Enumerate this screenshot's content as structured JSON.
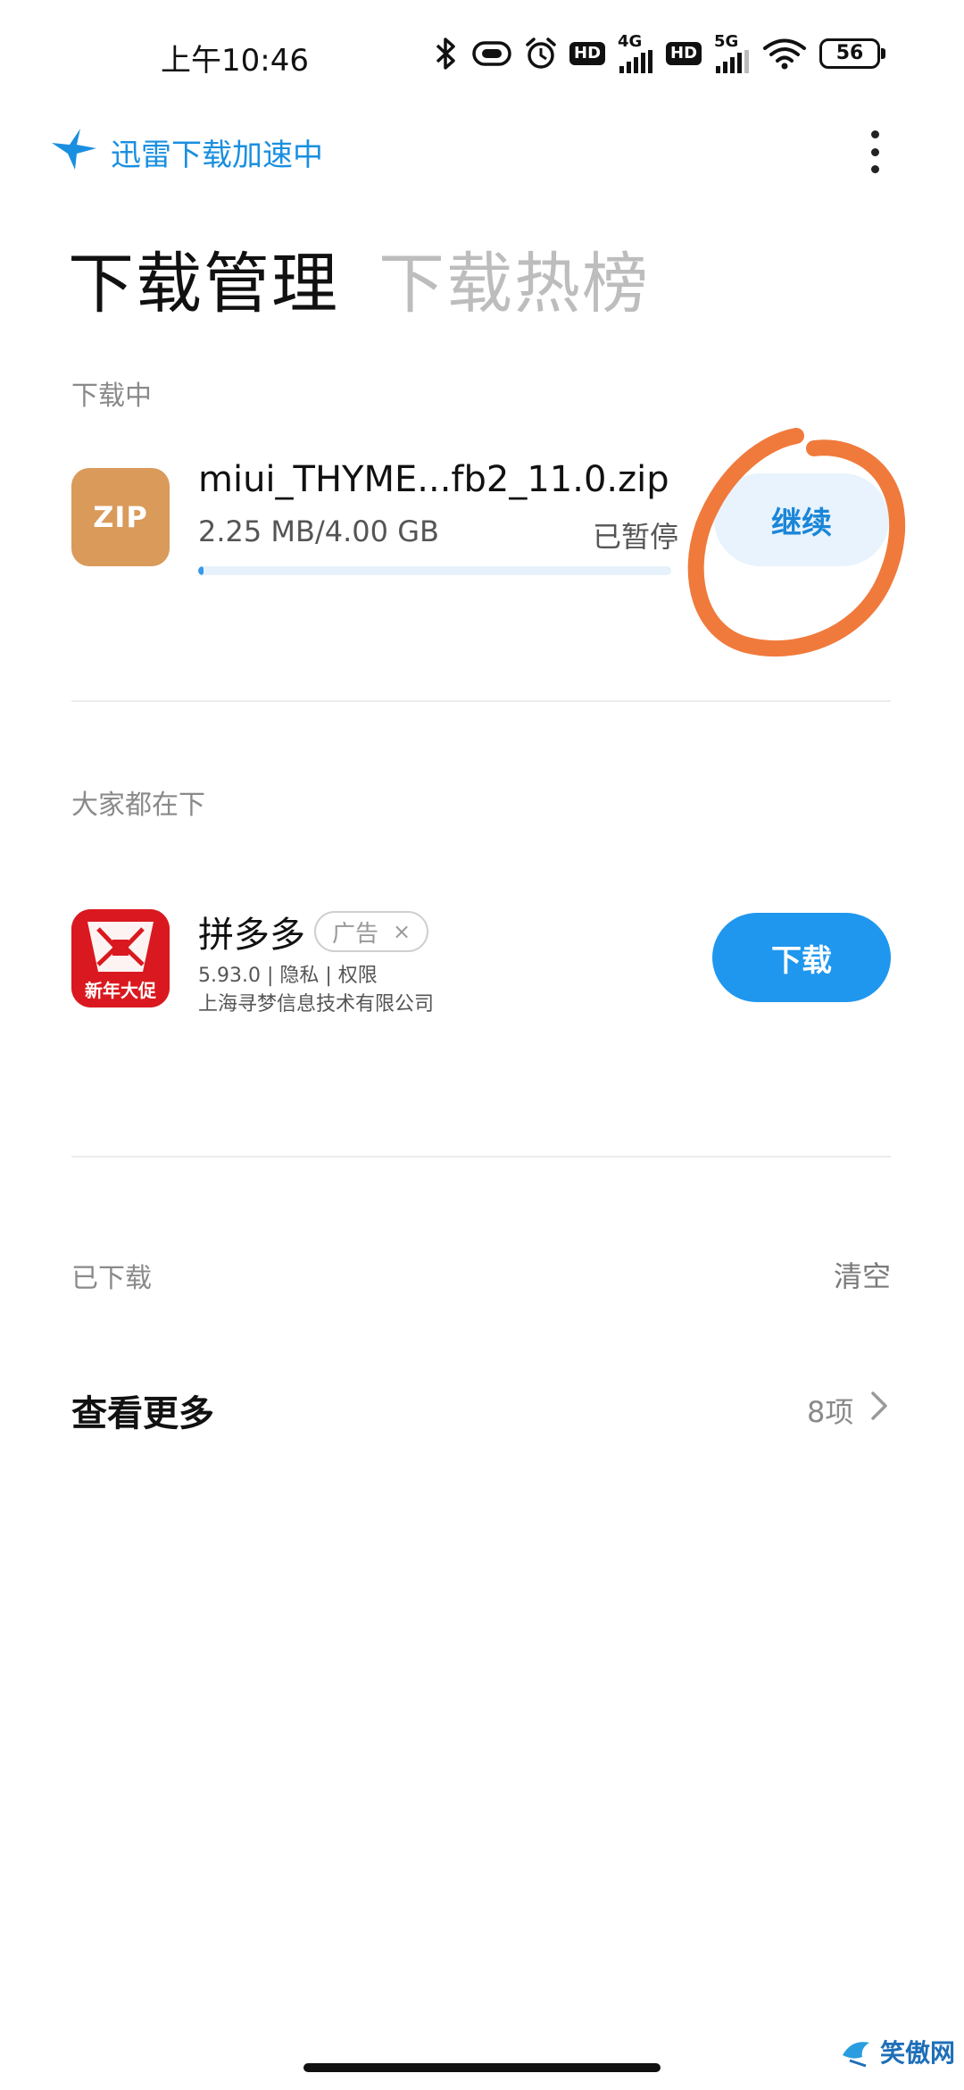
{
  "status_bar": {
    "time": "上午10:46",
    "net1_label": "4G",
    "net2_label": "5G",
    "hd_label": "HD",
    "battery": "56"
  },
  "banner": {
    "text": "迅雷下载加速中",
    "accent": "#1a8fe0"
  },
  "tabs": [
    {
      "label": "下载管理",
      "active": true
    },
    {
      "label": "下载热榜",
      "active": false
    }
  ],
  "downloading": {
    "section_label": "下载中",
    "item": {
      "icon_label": "ZIP",
      "file_name": "miui_THYME...fb2_11.0.zip",
      "size_text": "2.25 MB/4.00 GB",
      "status": "已暂停",
      "progress": 0.0056,
      "action_label": "继续"
    }
  },
  "recommend": {
    "section_label": "大家都在下",
    "item": {
      "name": "拼多多",
      "ad_label": "广告",
      "ad_close": "×",
      "meta": "5.93.0 | 隐私 | 权限",
      "publisher": "上海寻梦信息技术有限公司",
      "icon_caption": "新年大促",
      "action_label": "下载"
    }
  },
  "downloaded": {
    "section_label": "已下载",
    "clear_label": "清空",
    "see_more_label": "查看更多",
    "count_text": "8项"
  },
  "watermark": {
    "text": "笑傲网"
  }
}
